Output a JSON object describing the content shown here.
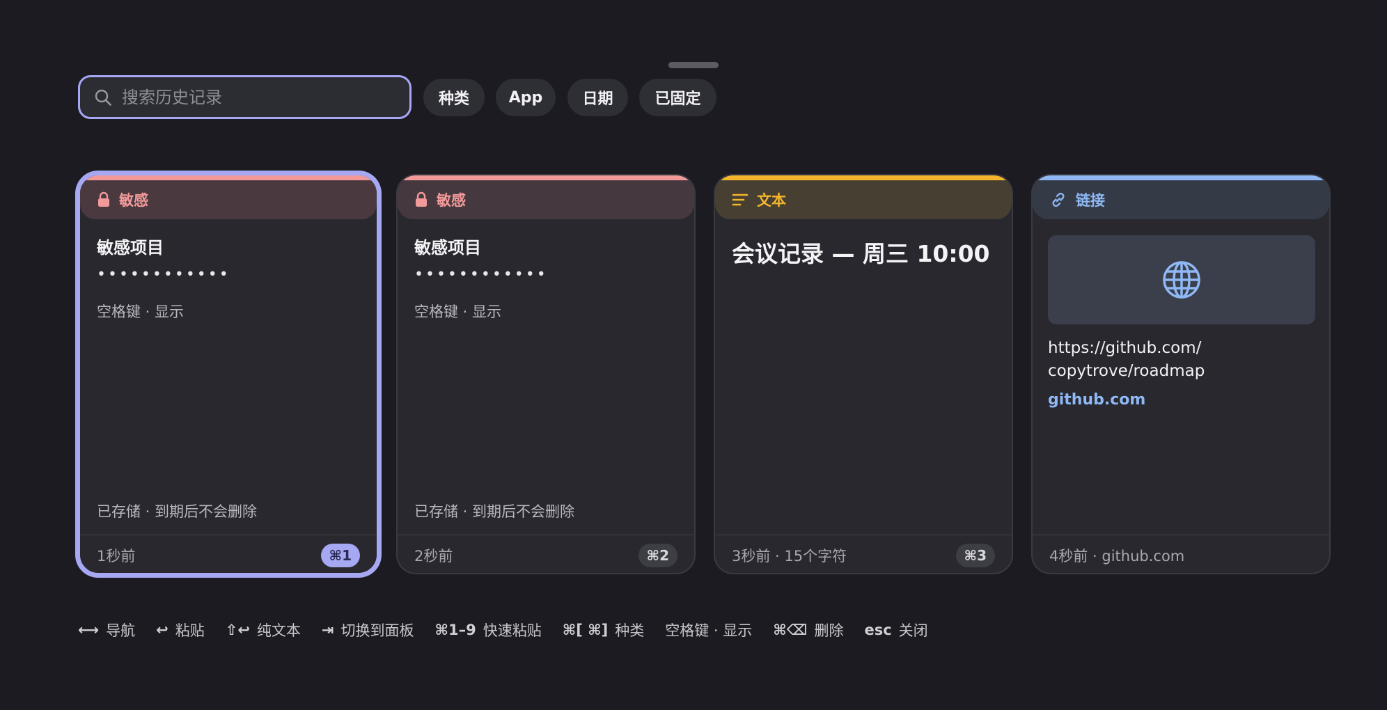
{
  "search": {
    "placeholder": "搜索历史记录"
  },
  "filters": [
    {
      "label": "种类"
    },
    {
      "label": "App"
    },
    {
      "label": "日期"
    },
    {
      "label": "已固定"
    }
  ],
  "colors": {
    "accent": "#a7a8f4",
    "sensitive": "#f29a9a",
    "text_type": "#f5b62e",
    "link_type": "#8fb8f4"
  },
  "cards": [
    {
      "type_label": "敏感",
      "type_icon": "lock-icon",
      "title": "敏感项目",
      "masked": "••••••••••••",
      "hint": "空格键 · 显示",
      "stored": "已存储 · 到期后不会删除",
      "meta": "1秒前",
      "shortcut": "⌘1"
    },
    {
      "type_label": "敏感",
      "type_icon": "lock-icon",
      "title": "敏感项目",
      "masked": "••••••••••••",
      "hint": "空格键 · 显示",
      "stored": "已存储 · 到期后不会删除",
      "meta": "2秒前",
      "shortcut": "⌘2"
    },
    {
      "type_label": "文本",
      "type_icon": "text-lines-icon",
      "content": "会议记录 — 周三 10:00",
      "meta": "3秒前 · 15个字符",
      "shortcut": "⌘3"
    },
    {
      "type_label": "链接",
      "type_icon": "link-icon",
      "preview_icon": "globe-icon",
      "url": "https://github.com/copytrove/roadmap",
      "url_line1": "https://github.com/",
      "url_line2": "copytrove/roadmap",
      "domain": "github.com",
      "meta": "4秒前 · github.com"
    }
  ],
  "shortcuts": [
    {
      "key": "⟷",
      "label": "导航"
    },
    {
      "key": "↩",
      "label": "粘贴"
    },
    {
      "key": "⇧↩",
      "label": "纯文本"
    },
    {
      "key": "⇥",
      "label": "切换到面板"
    },
    {
      "key": "⌘1–9",
      "label": "快速粘贴"
    },
    {
      "key": "⌘[ ⌘]",
      "label": "种类"
    },
    {
      "key": "",
      "label": "空格键 · 显示"
    },
    {
      "key": "⌘⌫",
      "label": "删除"
    },
    {
      "key": "esc",
      "label": "关闭"
    }
  ]
}
